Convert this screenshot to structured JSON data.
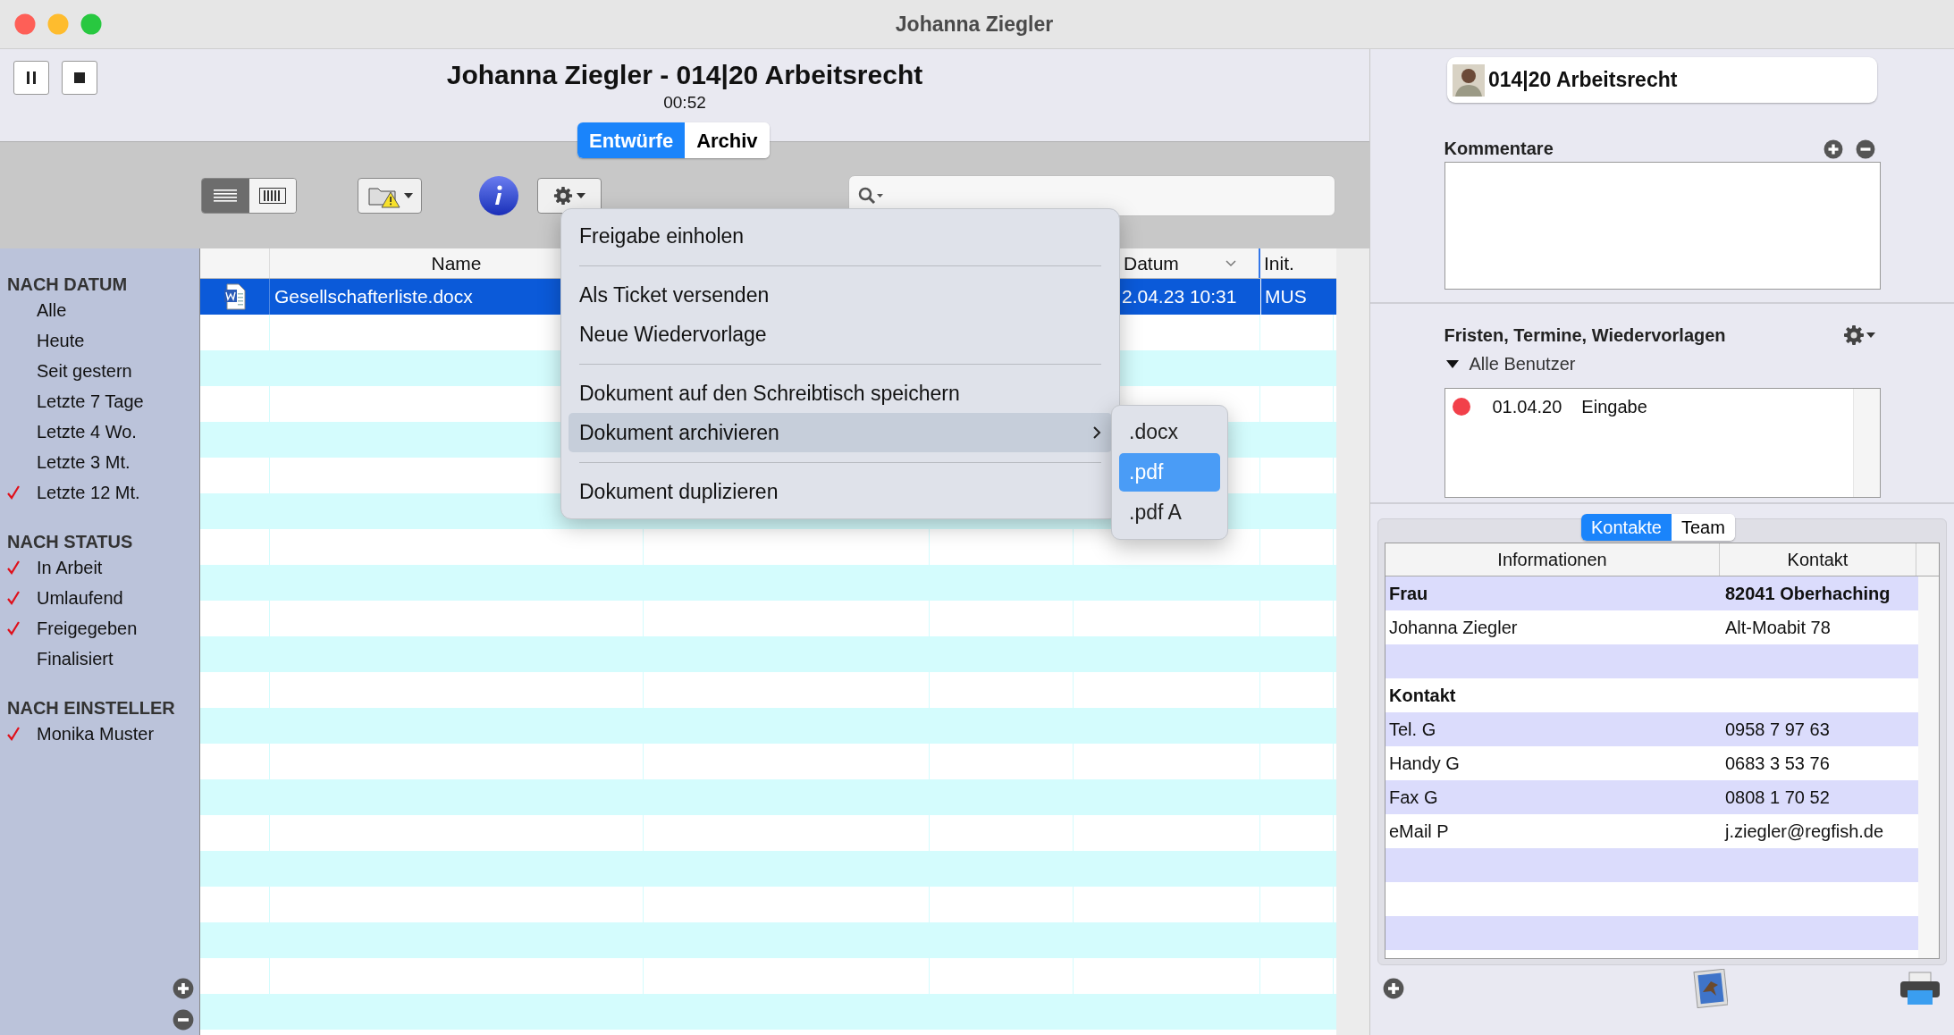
{
  "window": {
    "title": "Johanna Ziegler"
  },
  "header": {
    "title": "Johanna Ziegler - 014|20 Arbeitsrecht",
    "timer": "00:52"
  },
  "view_tabs": [
    {
      "label": "Entwürfe",
      "selected": true
    },
    {
      "label": "Archiv",
      "selected": false
    }
  ],
  "sidebar": {
    "sections": [
      {
        "heading": "NACH DATUM",
        "items": [
          {
            "label": "Alle",
            "checked": false
          },
          {
            "label": "Heute",
            "checked": false
          },
          {
            "label": "Seit gestern",
            "checked": false
          },
          {
            "label": "Letzte 7 Tage",
            "checked": false
          },
          {
            "label": "Letzte 4 Wo.",
            "checked": false
          },
          {
            "label": "Letzte 3 Mt.",
            "checked": false
          },
          {
            "label": "Letzte 12 Mt.",
            "checked": true
          }
        ]
      },
      {
        "heading": "NACH STATUS",
        "items": [
          {
            "label": "In Arbeit",
            "checked": true
          },
          {
            "label": "Umlaufend",
            "checked": true
          },
          {
            "label": "Freigegeben",
            "checked": true
          },
          {
            "label": "Finalisiert",
            "checked": false
          }
        ]
      },
      {
        "heading": "NACH EINSTELLER",
        "items": [
          {
            "label": "Monika Muster",
            "checked": true
          }
        ]
      }
    ]
  },
  "table": {
    "header": {
      "name": "Name",
      "date": "Datum",
      "initials": "Init."
    },
    "rows": [
      {
        "name": "Gesellschafterliste.docx",
        "date": "2.04.23 10:31",
        "initials": "MUS",
        "selected": true
      }
    ]
  },
  "menu": {
    "items": [
      {
        "kind": "item",
        "label": "Freigabe einholen",
        "highlighted": false
      },
      {
        "kind": "separator"
      },
      {
        "kind": "item",
        "label": "Als Ticket versenden",
        "highlighted": false
      },
      {
        "kind": "item",
        "label": "Neue Wiedervorlage",
        "highlighted": false
      },
      {
        "kind": "separator"
      },
      {
        "kind": "item",
        "label": "Dokument auf den Schreibtisch speichern",
        "highlighted": false
      },
      {
        "kind": "submenu",
        "label": "Dokument archivieren",
        "highlighted": true
      },
      {
        "kind": "separator"
      },
      {
        "kind": "item",
        "label": "Dokument duplizieren",
        "highlighted": false
      }
    ],
    "submenu": [
      {
        "label": ".docx",
        "selected": false
      },
      {
        "label": ".pdf",
        "selected": true
      },
      {
        "label": ".pdf A",
        "selected": false
      }
    ]
  },
  "case_card": {
    "title": "014|20 Arbeitsrecht"
  },
  "comments": {
    "heading": "Kommentare"
  },
  "deadlines": {
    "heading": "Fristen, Termine, Wiedervorlagen",
    "filter": "Alle Benutzer",
    "entries": [
      {
        "date": "01.04.20",
        "label": "Eingabe",
        "color": "#f2404a"
      }
    ]
  },
  "contact_tabs": [
    {
      "label": "Kontakte",
      "selected": true
    },
    {
      "label": "Team",
      "selected": false
    }
  ],
  "contacts": {
    "columns": [
      "Informationen",
      "Kontakt"
    ],
    "rows": [
      {
        "kind": "heading",
        "info": "Frau",
        "contact": "82041 Oberhaching"
      },
      {
        "kind": "entry",
        "info": "Johanna Ziegler",
        "contact": "Alt-Moabit 78"
      },
      {
        "kind": "blank"
      },
      {
        "kind": "heading",
        "info": "Kontakt"
      },
      {
        "kind": "entry",
        "info": "Tel. G",
        "contact": "0958 7 97 63"
      },
      {
        "kind": "entry",
        "info": "Handy G",
        "contact": "0683 3 53 76"
      },
      {
        "kind": "entry",
        "info": "Fax G",
        "contact": "0808 1 70 52"
      },
      {
        "kind": "entry",
        "info": "eMail P",
        "contact": "j.ziegler@regfish.de"
      }
    ]
  }
}
